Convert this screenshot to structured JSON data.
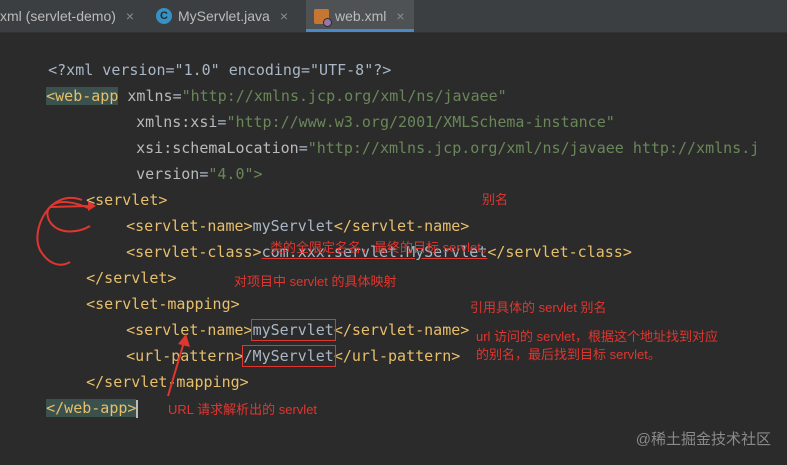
{
  "tabs": [
    {
      "label": "xml (servlet-demo)",
      "icon": "maven-icon",
      "active": false
    },
    {
      "label": "MyServlet.java",
      "icon": "java-class-icon",
      "active": false
    },
    {
      "label": "web.xml",
      "icon": "xml-file-icon",
      "active": true
    }
  ],
  "tab_close_glyph": "×",
  "code": {
    "l1_decl": "<?xml version=\"1.0\" encoding=\"UTF-8\"?>",
    "webapp_open": "<web-app",
    "xmlns_attr": "xmlns",
    "xmlns_val": "\"http://xmlns.jcp.org/xml/ns/javaee\"",
    "xsi_attr": "xmlns:xsi",
    "xsi_val": "\"http://www.w3.org/2001/XMLSchema-instance\"",
    "schema_attr": "xsi:schemaLocation",
    "schema_val": "\"http://xmlns.jcp.org/xml/ns/javaee http://xmlns.j",
    "version_attr": "version",
    "version_val": "\"4.0\">",
    "servlet_open": "<servlet>",
    "sn_open": "<servlet-name>",
    "sn_value": "myServlet",
    "sn_close": "</servlet-name>",
    "sc_open": "<servlet-class>",
    "sc_value": "com.xxx.servlet.MyServlet",
    "sc_close": "</servlet-class>",
    "servlet_close": "</servlet>",
    "sm_open": "<servlet-mapping>",
    "smn_open": "<servlet-name>",
    "smn_value": "myServlet",
    "smn_close": "</servlet-name>",
    "up_open": "<url-pattern>",
    "up_value": "/MyServlet",
    "up_close": "</url-pattern>",
    "sm_close": "</servlet-mapping>",
    "webapp_close": "</web-app>"
  },
  "annotations": {
    "alias": "别名",
    "class_full": "类的全限定名名，最终的目标 servlet。",
    "mapping": "对项目中 servlet 的具体映射",
    "ref_alias": "引用具体的 servlet 别名",
    "url_line1": "url 访问的 servlet，根据这个地址找到对应",
    "url_line2": "的别名，最后找到目标 servlet。",
    "url_parsed": "URL 请求解析出的 servlet"
  },
  "watermark": "@稀土掘金技术社区",
  "colors": {
    "background": "#2b2b2b",
    "tag": "#e8bf6a",
    "attribute": "#bababa",
    "string": "#6a8759",
    "annotation": "#e0362f",
    "tab_accent": "#4a88c7"
  }
}
